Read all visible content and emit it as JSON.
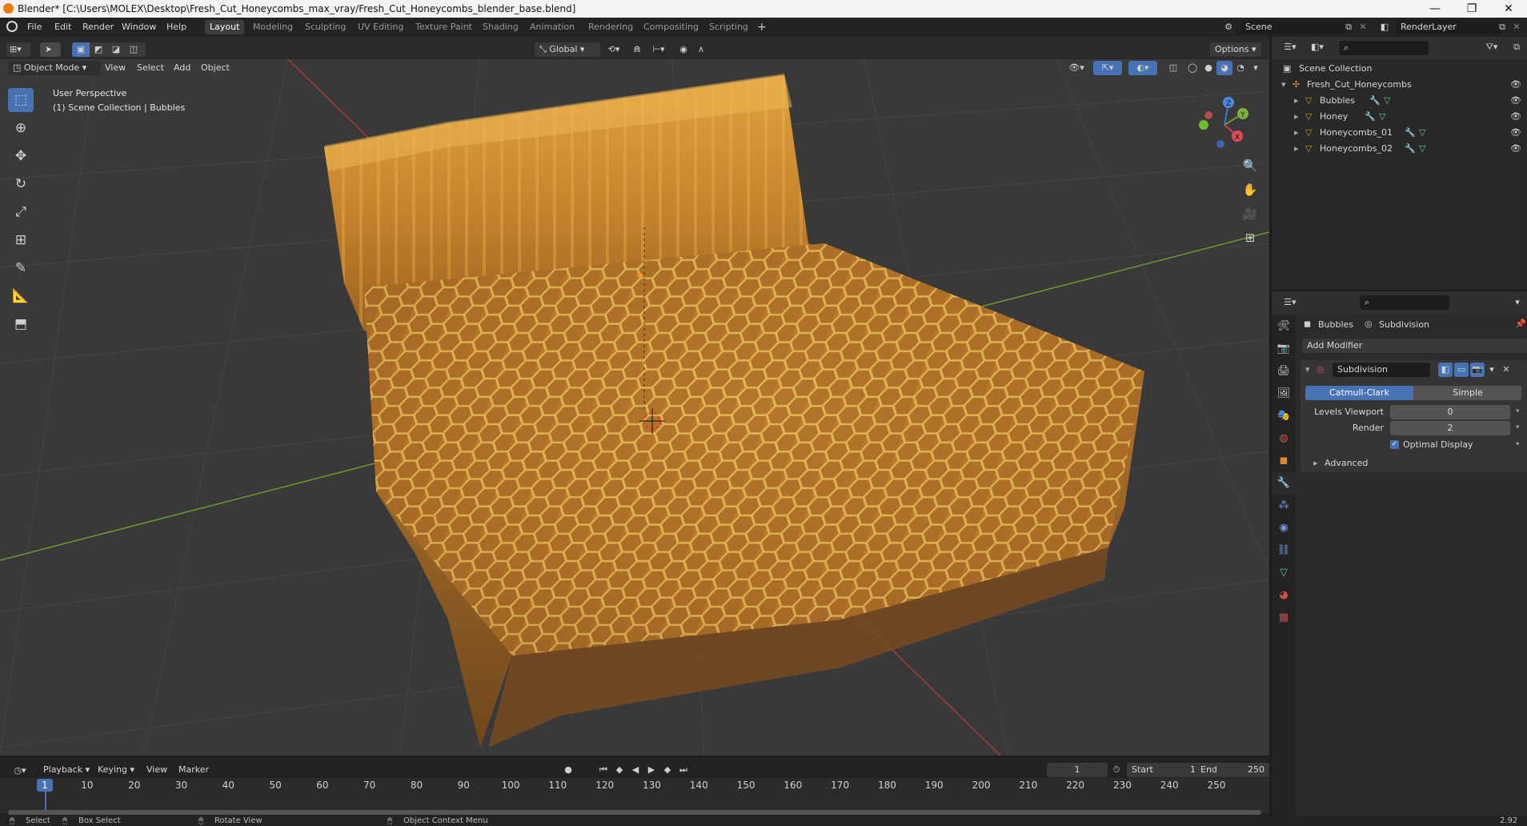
{
  "window": {
    "title": "Blender* [C:\\Users\\MOLEX\\Desktop\\Fresh_Cut_Honeycombs_max_vray/Fresh_Cut_Honeycombs_blender_base.blend]",
    "minimize": "—",
    "maximize": "❐",
    "close": "✕"
  },
  "menu": [
    "File",
    "Edit",
    "Render",
    "Window",
    "Help"
  ],
  "workspaces": [
    "Layout",
    "Modeling",
    "Sculpting",
    "UV Editing",
    "Texture Paint",
    "Shading",
    "Animation",
    "Rendering",
    "Compositing",
    "Scripting"
  ],
  "active_workspace": "Layout",
  "add_workspace": "+",
  "scene": {
    "value": "Scene"
  },
  "view_layer": {
    "value": "RenderLayer"
  },
  "viewport_header": {
    "mode": "Object Mode",
    "menus": [
      "View",
      "Select",
      "Add",
      "Object"
    ],
    "orientation": "Global",
    "options": "Options"
  },
  "viewport": {
    "perspective": "User Perspective",
    "collection_info": "(1) Scene Collection | Bubbles",
    "gizmo": {
      "x": "X",
      "y": "Y",
      "z": "Z"
    },
    "colors": {
      "bg": "#393939",
      "x_axis": "#a83a3f",
      "y_axis": "#6b9c2e",
      "honey": "#c98a2e",
      "wax": "#e8c25a"
    }
  },
  "outliner": {
    "root": "Scene Collection",
    "collection": "Fresh_Cut_Honeycombs",
    "objects": [
      "Bubbles",
      "Honey",
      "Honeycombs_01",
      "Honeycombs_02"
    ]
  },
  "properties": {
    "object": "Bubbles",
    "modifier_context": "Subdivision",
    "add_modifier": "Add Modifier",
    "modifier_name": "Subdivision",
    "algorithms": [
      "Catmull-Clark",
      "Simple"
    ],
    "active_algorithm": "Catmull-Clark",
    "levels_viewport_label": "Levels Viewport",
    "levels_viewport": "0",
    "render_label": "Render",
    "render_value": "2",
    "optimal_display": "Optimal Display",
    "advanced": "Advanced"
  },
  "timeline": {
    "menus": [
      "Playback",
      "Keying",
      "View",
      "Marker"
    ],
    "current_frame": "1",
    "start_label": "Start",
    "start": "1",
    "end_label": "End",
    "end": "250",
    "ticks": [
      "1",
      "10",
      "20",
      "30",
      "40",
      "50",
      "60",
      "70",
      "80",
      "90",
      "100",
      "110",
      "120",
      "130",
      "140",
      "150",
      "160",
      "170",
      "180",
      "190",
      "200",
      "210",
      "220",
      "230",
      "240",
      "250"
    ]
  },
  "status": {
    "select": "Select",
    "box_select": "Box Select",
    "rotate_view": "Rotate View",
    "context_menu": "Object Context Menu",
    "version": "2.92"
  }
}
